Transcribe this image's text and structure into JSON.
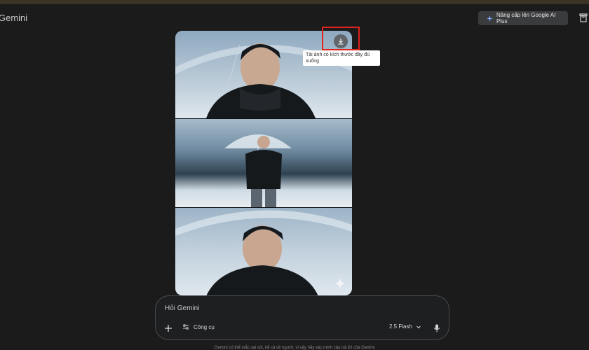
{
  "app": {
    "title": "Gemini"
  },
  "header": {
    "upgrade_label": "Nâng cấp lên Google AI Plus"
  },
  "image": {
    "tooltip": "Tải ảnh có kích thước đầy đủ xuống"
  },
  "composer": {
    "placeholder": "Hỏi Gemini",
    "tools_label": "Công cụ",
    "model_label": "2.5 Flash"
  },
  "footer": {
    "disclaimer": "Gemini có thể mắc sai sót, kể cả về người, vì vậy hãy xác minh câu trả lời của Gemini"
  },
  "colors": {
    "highlight": "#e0231b",
    "background": "#1b1b1c"
  },
  "icons": [
    "sparkle-icon",
    "trash-icon",
    "download-icon",
    "plus-icon",
    "tune-icon",
    "chevron-down-icon",
    "mic-icon"
  ]
}
